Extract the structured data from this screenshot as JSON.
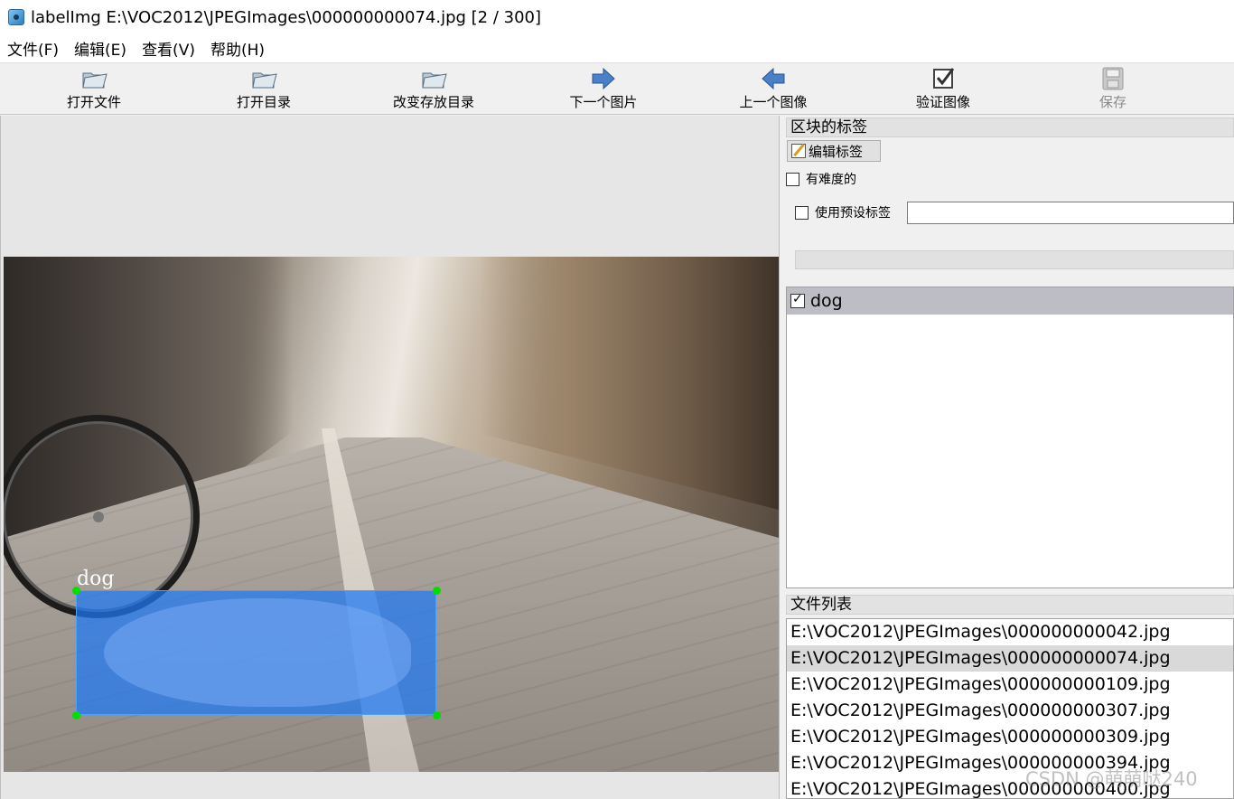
{
  "window": {
    "title": "labelImg E:\\VOC2012\\JPEGImages\\000000000074.jpg [2 / 300]",
    "accent_colors": [
      "#22b14c",
      "#22b14c",
      "#3a86f0",
      "#3a86f0"
    ]
  },
  "menu": [
    "文件(F)",
    "编辑(E)",
    "查看(V)",
    "帮助(H)"
  ],
  "toolbar": [
    {
      "label": "打开文件",
      "icon": "folder-open-icon",
      "enabled": true
    },
    {
      "label": "打开目录",
      "icon": "folder-open-icon",
      "enabled": true
    },
    {
      "label": "改变存放目录",
      "icon": "folder-open-icon",
      "enabled": true
    },
    {
      "label": "下一个图片",
      "icon": "arrow-right-icon",
      "enabled": true
    },
    {
      "label": "上一个图像",
      "icon": "arrow-left-icon",
      "enabled": true
    },
    {
      "label": "验证图像",
      "icon": "checkbox-verify-icon",
      "enabled": true
    },
    {
      "label": "保存",
      "icon": "save-disk-icon",
      "enabled": false
    }
  ],
  "canvas": {
    "bbox_label": "dog",
    "bbox_fill": "#1e78f5",
    "corner_color": "#00e000"
  },
  "label_panel": {
    "title": "区块的标签",
    "edit_label_button": "编辑标签",
    "difficult_label": "有难度的",
    "difficult_checked": false,
    "use_default_label": "使用预设标签",
    "use_default_checked": false,
    "default_label_value": "",
    "labels": [
      {
        "text": "dog",
        "checked": true
      }
    ]
  },
  "file_panel": {
    "title": "文件列表",
    "files": [
      "E:\\VOC2012\\JPEGImages\\000000000042.jpg",
      "E:\\VOC2012\\JPEGImages\\000000000074.jpg",
      "E:\\VOC2012\\JPEGImages\\000000000109.jpg",
      "E:\\VOC2012\\JPEGImages\\000000000307.jpg",
      "E:\\VOC2012\\JPEGImages\\000000000309.jpg",
      "E:\\VOC2012\\JPEGImages\\000000000394.jpg",
      "E:\\VOC2012\\JPEGImages\\000000000400.jpg"
    ],
    "selected_index": 1
  },
  "watermark": "CSDN @萌萌哒240"
}
